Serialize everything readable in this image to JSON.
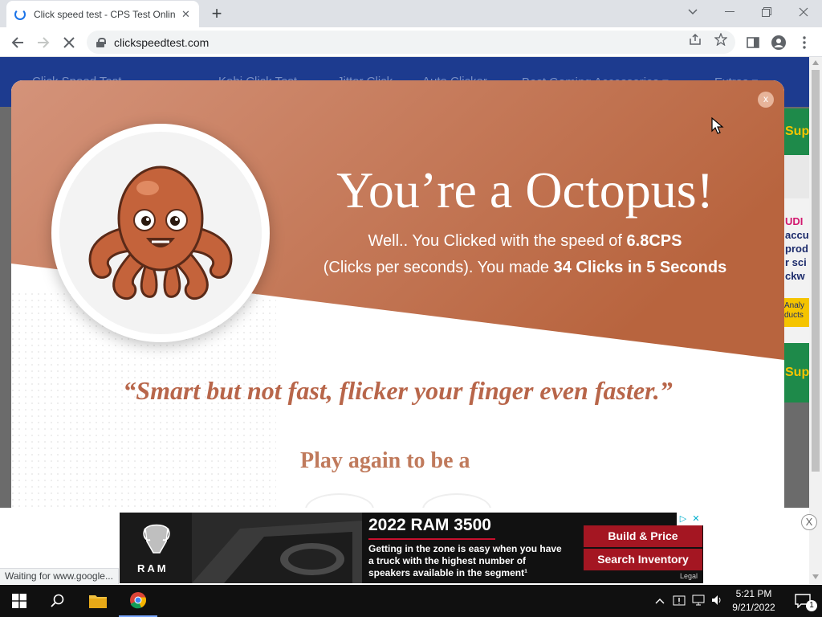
{
  "browser": {
    "tab_title": "Click speed test - CPS Test Online",
    "tab_close": "✕",
    "new_tab": "+",
    "url": "clickspeedtest.com",
    "status": "Waiting for www.google..."
  },
  "site_nav": [
    "Click Speed Test",
    "Kohi Click Test",
    "Jitter Click",
    "Auto Clicker",
    "Best Gaming Accessories ▾",
    "Extras ▾"
  ],
  "side_ad": {
    "top_text": "Sup",
    "middle_lines": [
      "UDI",
      "accu",
      "prod",
      "r sci",
      "ckw"
    ],
    "badge": "Analy ducts",
    "bottom_text": "Sup"
  },
  "modal": {
    "close_label": "x",
    "headline": "You’re a Octopus!",
    "line1_prefix": "Well.. You Clicked with the speed of ",
    "cps_value": "6.8CPS",
    "line2_prefix": "(Clicks per seconds). You made ",
    "clicks_summary": "34 Clicks in 5 Seconds",
    "quote": "“Smart but not fast, flicker your finger even faster.”",
    "play_again": "Play again to be a",
    "mascot": "octopus"
  },
  "ad": {
    "brand": "RAM",
    "title": "2022 RAM 3500",
    "body": "Getting in the zone is easy when you have a truck with the highest number of speakers available in the segment¹",
    "buttons": [
      "Build & Price",
      "Search Inventory"
    ],
    "legal": "Legal",
    "dismiss": "X",
    "choices_icon": "▷",
    "choices_close": "✕"
  },
  "taskbar": {
    "time": "5:21 PM",
    "date": "9/21/2022",
    "notification_count": "1"
  },
  "colors": {
    "modal_gradient_start": "#d4937a",
    "modal_gradient_end": "#b8643e",
    "quote": "#b8664a",
    "nav_bar": "#1d3b8f",
    "ad_button": "#a41622"
  }
}
